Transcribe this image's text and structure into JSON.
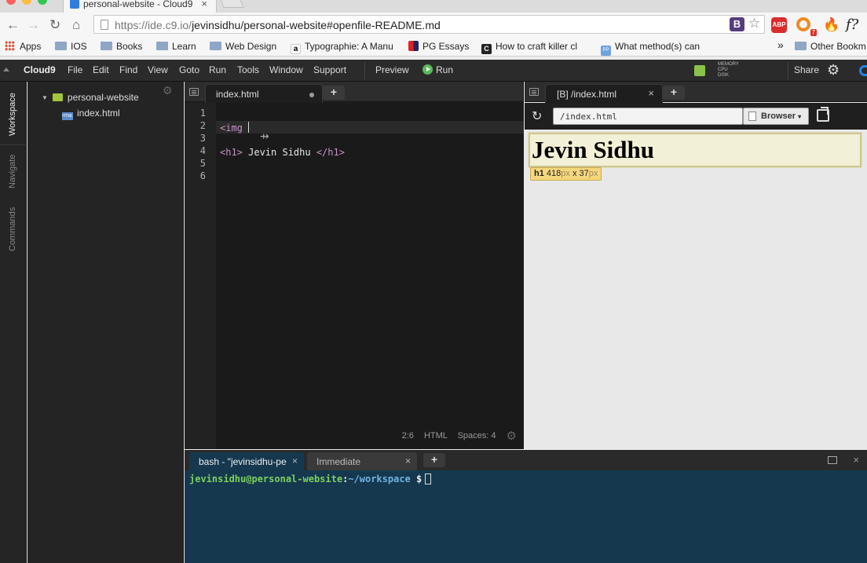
{
  "browser": {
    "tab_title": "personal-website - Cloud9",
    "tab_close": "×",
    "url_host": "https://ide.c9.io/",
    "url_path": "jevinsidhu/personal-website#openfile-README.md",
    "ext_bootstrap": "B",
    "ext_abp": "ABP",
    "ext_badge_count": "7",
    "ext_fq": "f?",
    "bookmarks": [
      {
        "label": "Apps",
        "icon": "apps-grid-icon"
      },
      {
        "label": "IOS",
        "icon": "folder-icon"
      },
      {
        "label": "Books",
        "icon": "folder-icon"
      },
      {
        "label": "Learn",
        "icon": "folder-icon"
      },
      {
        "label": "Web Design",
        "icon": "folder-icon"
      },
      {
        "label": "Typographie: A Manu",
        "icon": "amazon-icon"
      },
      {
        "label": "PG Essays",
        "icon": "pg-icon"
      },
      {
        "label": "How to craft killer cl",
        "icon": "c-icon"
      },
      {
        "label": "What method(s) can",
        "icon": "pp-icon"
      }
    ],
    "bookmarks_overflow": "»",
    "other_bookmarks": "Other Bookm"
  },
  "c9": {
    "brand": "Cloud9",
    "menu": [
      "File",
      "Edit",
      "Find",
      "View",
      "Goto",
      "Run",
      "Tools",
      "Window",
      "Support"
    ],
    "preview": "Preview",
    "run": "Run",
    "meters": [
      "MEMORY",
      "CPU",
      "DISK"
    ],
    "share": "Share"
  },
  "sidebar": {
    "tabs": [
      "Workspace",
      "Navigate",
      "Commands"
    ]
  },
  "tree": {
    "root": "personal-website",
    "files": [
      "index.html"
    ]
  },
  "editor": {
    "tab_label": "index.html",
    "line_numbers": [
      "1",
      "2",
      "3",
      "4",
      "5",
      "6"
    ],
    "line2": "<img ",
    "line4_open": "<h1>",
    "line4_text": " Jevin Sidhu ",
    "line4_close": "</h1>",
    "status": {
      "position": "2:6",
      "mode": "HTML",
      "spaces": "Spaces: 4"
    }
  },
  "preview": {
    "tab_label": "[B] /index.html",
    "address": "/index.html",
    "browser_button": "Browser",
    "heading": "Jevin Sidhu",
    "tooltip_tag": "h1",
    "tooltip_w": "418",
    "tooltip_unit": "px",
    "tooltip_x": " x ",
    "tooltip_h": "37"
  },
  "terminal": {
    "tabs": [
      "bash - \"jevinsidhu-pe",
      "Immediate"
    ],
    "user": "jevinsidhu@personal-website",
    "colon": ":",
    "path": "~/workspace",
    "prompt": " $"
  }
}
